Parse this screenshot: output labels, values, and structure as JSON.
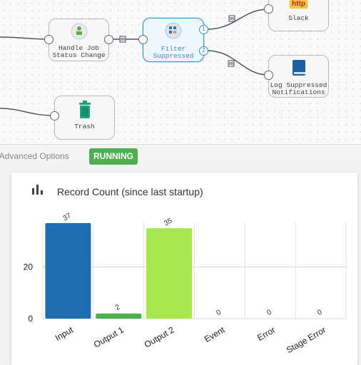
{
  "pipeline": {
    "nodes": {
      "handle_job": {
        "line1": "Handle Job",
        "line2": "Status Change"
      },
      "filter": {
        "line1": "Filter",
        "line2": "Suppressed"
      },
      "slack": {
        "label": "Slack",
        "badge": "http"
      },
      "log": {
        "line1": "Log Suppressed",
        "line2": "Notifications"
      },
      "trash": {
        "label": "Trash"
      }
    },
    "ports": {
      "out1": "1",
      "out2": "2"
    }
  },
  "status_bar": {
    "advanced_options": "v Advanced Options",
    "status": "RUNNING"
  },
  "card": {
    "title": "Record Count (since last startup)",
    "icon": "bar-chart-icon"
  },
  "colors": {
    "input": "#1f6db3",
    "output1": "#4caf50",
    "output2": "#a8e84f",
    "running": "#4caf50"
  },
  "chart_data": {
    "type": "bar",
    "title": "Record Count (since last startup)",
    "categories": [
      "Input",
      "Output 1",
      "Output 2",
      "Event",
      "Error",
      "Stage Error"
    ],
    "values": [
      37,
      2,
      35,
      0,
      0,
      0
    ],
    "data_labels": [
      "37",
      "2",
      "35",
      "0",
      "0",
      "0"
    ],
    "yticks": [
      0,
      20
    ],
    "ylim": [
      0,
      40
    ],
    "grid": true
  }
}
